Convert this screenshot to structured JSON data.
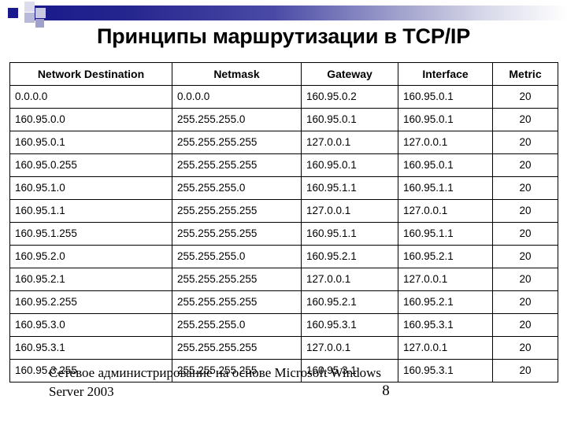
{
  "slide": {
    "title": "Принципы маршрутизации в TCP/IP",
    "banner_accent_color": "#1a1a8c",
    "banner_fade_color": "#ffffff"
  },
  "table": {
    "headers": [
      "Network Destination",
      "Netmask",
      "Gateway",
      "Interface",
      "Metric"
    ],
    "rows": [
      {
        "destination": "0.0.0.0",
        "netmask": "0.0.0.0",
        "gateway": "160.95.0.2",
        "interface": "160.95.0.1",
        "metric": "20"
      },
      {
        "destination": "160.95.0.0",
        "netmask": "255.255.255.0",
        "gateway": "160.95.0.1",
        "interface": "160.95.0.1",
        "metric": "20"
      },
      {
        "destination": "160.95.0.1",
        "netmask": "255.255.255.255",
        "gateway": "127.0.0.1",
        "interface": "127.0.0.1",
        "metric": "20"
      },
      {
        "destination": "160.95.0.255",
        "netmask": "255.255.255.255",
        "gateway": "160.95.0.1",
        "interface": "160.95.0.1",
        "metric": "20"
      },
      {
        "destination": "160.95.1.0",
        "netmask": "255.255.255.0",
        "gateway": "160.95.1.1",
        "interface": "160.95.1.1",
        "metric": "20"
      },
      {
        "destination": "160.95.1.1",
        "netmask": "255.255.255.255",
        "gateway": "127.0.0.1",
        "interface": "127.0.0.1",
        "metric": "20"
      },
      {
        "destination": "160.95.1.255",
        "netmask": "255.255.255.255",
        "gateway": "160.95.1.1",
        "interface": "160.95.1.1",
        "metric": "20"
      },
      {
        "destination": "160.95.2.0",
        "netmask": "255.255.255.0",
        "gateway": "160.95.2.1",
        "interface": "160.95.2.1",
        "metric": "20"
      },
      {
        "destination": "160.95.2.1",
        "netmask": "255.255.255.255",
        "gateway": "127.0.0.1",
        "interface": "127.0.0.1",
        "metric": "20"
      },
      {
        "destination": "160.95.2.255",
        "netmask": "255.255.255.255",
        "gateway": "160.95.2.1",
        "interface": "160.95.2.1",
        "metric": "20"
      },
      {
        "destination": "160.95.3.0",
        "netmask": "255.255.255.0",
        "gateway": "160.95.3.1",
        "interface": "160.95.3.1",
        "metric": "20"
      },
      {
        "destination": "160.95.3.1",
        "netmask": "255.255.255.255",
        "gateway": "127.0.0.1",
        "interface": "127.0.0.1",
        "metric": "20"
      },
      {
        "destination": "160.95.3.255",
        "netmask": "255.255.255.255",
        "gateway": "160.95.3.1",
        "interface": "160.95.3.1",
        "metric": "20"
      }
    ]
  },
  "footer": {
    "text": "Сетевое администрирование на основе Microsoft Windows Server 2003",
    "page_number": "8"
  }
}
